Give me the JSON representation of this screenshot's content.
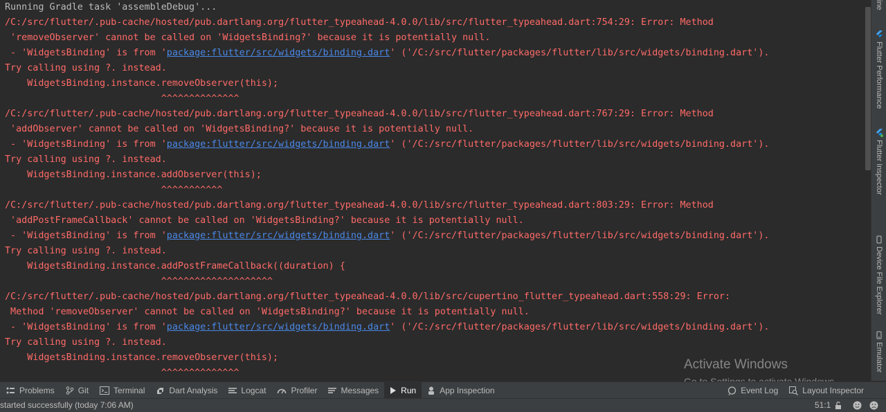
{
  "console": {
    "lines": [
      {
        "text": "Running Gradle task 'assembleDebug'...",
        "kind": "plain"
      },
      {
        "text": "/C:/src/flutter/.pub-cache/hosted/pub.dartlang.org/flutter_typeahead-4.0.0/lib/src/flutter_typeahead.dart:754:29: Error: Method",
        "kind": "err"
      },
      {
        "text": " 'removeObserver' cannot be called on 'WidgetsBinding?' because it is potentially null.",
        "kind": "err"
      },
      {
        "pre": " - 'WidgetsBinding' is from '",
        "link": "package:flutter/src/widgets/binding.dart",
        "post": "' ('/C:/src/flutter/packages/flutter/lib/src/widgets/binding.dart').",
        "kind": "link"
      },
      {
        "text": "Try calling using ?. instead.",
        "kind": "err"
      },
      {
        "text": "    WidgetsBinding.instance.removeObserver(this);",
        "kind": "err"
      },
      {
        "text": "                            ^^^^^^^^^^^^^^",
        "kind": "err"
      },
      {
        "text": "/C:/src/flutter/.pub-cache/hosted/pub.dartlang.org/flutter_typeahead-4.0.0/lib/src/flutter_typeahead.dart:767:29: Error: Method",
        "kind": "err"
      },
      {
        "text": " 'addObserver' cannot be called on 'WidgetsBinding?' because it is potentially null.",
        "kind": "err"
      },
      {
        "pre": " - 'WidgetsBinding' is from '",
        "link": "package:flutter/src/widgets/binding.dart",
        "post": "' ('/C:/src/flutter/packages/flutter/lib/src/widgets/binding.dart').",
        "kind": "link"
      },
      {
        "text": "Try calling using ?. instead.",
        "kind": "err"
      },
      {
        "text": "    WidgetsBinding.instance.addObserver(this);",
        "kind": "err"
      },
      {
        "text": "                            ^^^^^^^^^^^",
        "kind": "err"
      },
      {
        "text": "/C:/src/flutter/.pub-cache/hosted/pub.dartlang.org/flutter_typeahead-4.0.0/lib/src/flutter_typeahead.dart:803:29: Error: Method",
        "kind": "err"
      },
      {
        "text": " 'addPostFrameCallback' cannot be called on 'WidgetsBinding?' because it is potentially null.",
        "kind": "err"
      },
      {
        "pre": " - 'WidgetsBinding' is from '",
        "link": "package:flutter/src/widgets/binding.dart",
        "post": "' ('/C:/src/flutter/packages/flutter/lib/src/widgets/binding.dart').",
        "kind": "link"
      },
      {
        "text": "Try calling using ?. instead.",
        "kind": "err"
      },
      {
        "text": "    WidgetsBinding.instance.addPostFrameCallback((duration) {",
        "kind": "err"
      },
      {
        "text": "                            ^^^^^^^^^^^^^^^^^^^^",
        "kind": "err"
      },
      {
        "text": "/C:/src/flutter/.pub-cache/hosted/pub.dartlang.org/flutter_typeahead-4.0.0/lib/src/cupertino_flutter_typeahead.dart:558:29: Error:",
        "kind": "err"
      },
      {
        "text": " Method 'removeObserver' cannot be called on 'WidgetsBinding?' because it is potentially null.",
        "kind": "err"
      },
      {
        "pre": " - 'WidgetsBinding' is from '",
        "link": "package:flutter/src/widgets/binding.dart",
        "post": "' ('/C:/src/flutter/packages/flutter/lib/src/widgets/binding.dart').",
        "kind": "link"
      },
      {
        "text": "Try calling using ?. instead.",
        "kind": "err"
      },
      {
        "text": "    WidgetsBinding.instance.removeObserver(this);",
        "kind": "err"
      },
      {
        "text": "                            ^^^^^^^^^^^^^^",
        "kind": "err"
      }
    ]
  },
  "right_panel": {
    "top_clip": "ine",
    "flutter_performance": "Flutter Performance",
    "flutter_inspector": "Flutter Inspector",
    "device_file_explorer": "Device File Explorer",
    "emulator": "Emulator"
  },
  "watermark": {
    "title": "Activate Windows",
    "subtitle": "Go to Settings to activate Windows."
  },
  "toolbar": {
    "problems": "Problems",
    "git": "Git",
    "terminal": "Terminal",
    "dart_analysis": "Dart Analysis",
    "logcat": "Logcat",
    "profiler": "Profiler",
    "messages": "Messages",
    "run": "Run",
    "app_inspection": "App Inspection",
    "event_log": "Event Log",
    "layout_inspector": "Layout Inspector"
  },
  "status": {
    "text": "started successfully (today 7:06 AM)",
    "cursor": "51:1"
  },
  "colors": {
    "background": "#2b2b2b",
    "error_text": "#ff6b68",
    "plain_text": "#bbbbbb",
    "link": "#4a88e8",
    "bar": "#3c3f41"
  }
}
